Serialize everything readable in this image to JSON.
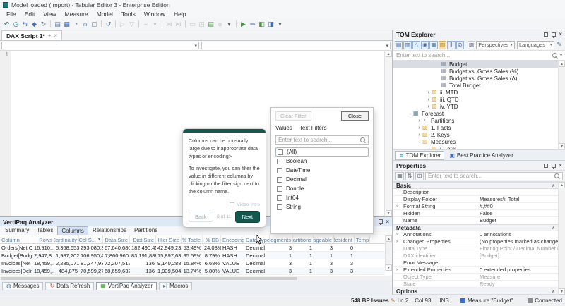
{
  "title_bar": {
    "title": "Model loaded (Import) - Tabular Editor 3 - Enterprise Edition"
  },
  "menu": [
    "File",
    "Edit",
    "View",
    "Measure",
    "Model",
    "Tools",
    "Window",
    "Help"
  ],
  "toolbar_icons": [
    {
      "name": "undo-icon",
      "g": "↶",
      "c": "#1f7a7a"
    },
    {
      "name": "history-icon",
      "g": "◷",
      "c": "#1f7a7a"
    },
    {
      "name": "sync-icon",
      "g": "⇆",
      "c": "#3a6bc9"
    },
    {
      "name": "deploy-icon",
      "g": "◆",
      "c": "#3a6bc9"
    },
    {
      "name": "refresh-icon",
      "g": "↻",
      "c": "#3a6bc9"
    },
    {
      "sep": true
    },
    {
      "name": "new-script-icon",
      "g": "▤",
      "c": "#5a7a9a"
    },
    {
      "name": "new-query-icon",
      "g": "▦",
      "c": "#3a6bc9"
    },
    {
      "name": "notifications-icon",
      "g": "◔",
      "c": "#5a7a9a"
    },
    {
      "name": "branch-icon",
      "g": "⋔",
      "c": "#5a7a9a"
    },
    {
      "name": "package-icon",
      "g": "▢",
      "c": "#5a7a9a"
    },
    {
      "sep": true
    },
    {
      "name": "refresh-model-icon",
      "g": "↺",
      "c": "#3a6bc9"
    },
    {
      "sep": true
    },
    {
      "name": "run-icon",
      "g": "▷",
      "c": "#777",
      "m": true
    },
    {
      "name": "stop-icon",
      "g": "▽",
      "c": "#777",
      "m": true
    },
    {
      "sep": true
    },
    {
      "name": "format-dax-icon",
      "g": "≡",
      "c": "#777",
      "m": true
    },
    {
      "name": "format-dropdown-icon",
      "g": "▾",
      "c": "#777",
      "m": true
    },
    {
      "sep": true
    },
    {
      "name": "hourglass-icon",
      "g": "⋈",
      "c": "#777",
      "m": true
    },
    {
      "name": "hourglass-alt-icon",
      "g": "⋈",
      "c": "#777",
      "m": true
    },
    {
      "sep": true
    },
    {
      "name": "comment-icon",
      "g": "▭",
      "c": "#777",
      "m": true
    },
    {
      "name": "chat-icon",
      "g": "◳",
      "c": "#777",
      "m": true
    },
    {
      "name": "save-layout-icon",
      "g": "▤",
      "c": "#3f9c35"
    },
    {
      "name": "tips-icon",
      "g": "☼",
      "c": "#999"
    },
    {
      "name": "tips-dropdown-icon",
      "g": "▾",
      "c": "#666"
    },
    {
      "sep": true
    },
    {
      "name": "play-icon",
      "g": "▶",
      "c": "#3f9c35"
    },
    {
      "name": "debug-icon",
      "g": "⇒",
      "c": "#3a6bc9"
    },
    {
      "name": "run-batch-icon",
      "g": "◧",
      "c": "#3f9c35"
    },
    {
      "name": "export-icon",
      "g": "◨",
      "c": "#3a6bc9"
    },
    {
      "name": "run-dropdown-icon",
      "g": "▾",
      "c": "#666"
    }
  ],
  "editor": {
    "tab_label": "DAX Script 1*",
    "new_tab_glyph": "+",
    "close_glyph": "×",
    "line1": "1"
  },
  "tom": {
    "title": "TOM Explorer",
    "toolbar_icons": [
      {
        "name": "toggle-measures-icon",
        "g": "▤",
        "style": "on"
      },
      {
        "name": "toggle-columns-icon",
        "g": "▥",
        "style": "on"
      },
      {
        "name": "toggle-hierarchies-icon",
        "g": "△",
        "style": "on"
      },
      {
        "name": "toggle-kpis-icon",
        "g": "◉",
        "style": "on"
      },
      {
        "name": "toggle-tables-icon",
        "g": "▦",
        "style": "on"
      },
      {
        "name": "toggle-folders-icon",
        "g": "▧",
        "style": "folder"
      },
      {
        "name": "toggle-hidden-icon",
        "g": "‖",
        "style": "on"
      },
      {
        "name": "toggle-disconnected-icon",
        "g": "⊘",
        "style": "on"
      },
      {
        "name": "flat-list-icon",
        "g": "▩",
        "style": "off"
      }
    ],
    "perspectives_label": "Perspectives",
    "languages_label": "Languages",
    "search_placeholder": "Enter text to search...",
    "tree": [
      {
        "label": "Budget",
        "type": "measure",
        "depth": 4,
        "selected": true
      },
      {
        "label": "Budget vs. Gross Sales (%)",
        "type": "measure",
        "depth": 4
      },
      {
        "label": "Budget vs. Gross Sales (Δ)",
        "type": "measure",
        "depth": 4
      },
      {
        "label": "Total Budget",
        "type": "measure",
        "depth": 4
      },
      {
        "label": "ii. MTD",
        "type": "folder",
        "depth": 3,
        "exp": "collapsed"
      },
      {
        "label": "iii. QTD",
        "type": "folder",
        "depth": 3,
        "exp": "collapsed"
      },
      {
        "label": "iv. YTD",
        "type": "folder",
        "depth": 3,
        "exp": "collapsed"
      },
      {
        "label": "Forecast",
        "type": "table",
        "depth": 1,
        "exp": "expanded"
      },
      {
        "label": "Partitions",
        "type": "partitions",
        "depth": 2,
        "exp": "collapsed"
      },
      {
        "label": "1. Facts",
        "type": "folder",
        "depth": 2,
        "exp": "collapsed"
      },
      {
        "label": "2. Keys",
        "type": "folder",
        "depth": 2,
        "exp": "collapsed"
      },
      {
        "label": "Measures",
        "type": "folder-open",
        "depth": 2,
        "exp": "expanded"
      },
      {
        "label": "i. Total",
        "type": "folder-open",
        "depth": 3,
        "exp": "expanded"
      }
    ],
    "tabs": [
      {
        "label": "TOM Explorer",
        "active": true
      },
      {
        "label": "Best Practice Analyzer",
        "active": false
      }
    ]
  },
  "properties": {
    "title": "Properties",
    "search_placeholder": "Enter text to search...",
    "sections": [
      {
        "name": "Basic",
        "rows": [
          {
            "label": "Description",
            "value": ""
          },
          {
            "label": "Display Folder",
            "value": "Measures\\i. Total"
          },
          {
            "label": "Format String",
            "value": "#,##0",
            "expand": true
          },
          {
            "label": "Hidden",
            "value": "False"
          },
          {
            "label": "Name",
            "value": "Budget"
          }
        ]
      },
      {
        "name": "Metadata",
        "rows": [
          {
            "label": "Annotations",
            "value": "0 annotations",
            "expand": true
          },
          {
            "label": "Changed Properties",
            "value": "(No properties marked as changed)",
            "expand": true
          },
          {
            "label": "Data Type",
            "value": "Floating Point / Decimal Number (dou...",
            "muted": true
          },
          {
            "label": "DAX identifier",
            "value": "[Budget]",
            "muted": true
          },
          {
            "label": "Error Message",
            "value": ""
          },
          {
            "label": "Extended Properties",
            "value": "0 extended properties",
            "expand": true
          },
          {
            "label": "Object Type",
            "value": "Measure",
            "muted": true
          },
          {
            "label": "State",
            "value": "Ready",
            "muted": true
          }
        ]
      },
      {
        "name": "Options",
        "rows": []
      }
    ]
  },
  "vertipaq": {
    "title": "VertiPaq Analyzer",
    "tabs": [
      "Summary",
      "Tables",
      "Columns",
      "Relationships",
      "Partitions"
    ],
    "active_tab": "Columns",
    "columns": [
      "Column",
      "Rows",
      "Cardinality",
      "Col S...",
      "Data Size",
      "Dict Size",
      "Hier Size",
      "% Table",
      "% DB",
      "Encoding",
      "Data Type",
      "Segments",
      "Partitions",
      "Pageable",
      "Resident",
      "Temper..."
    ],
    "sorted_column_index": 3,
    "rows": [
      [
        "Orders[Net Or...",
        "16,910,...",
        "5,368,653",
        "293,080,3...",
        "67,640,680",
        "182,490,456",
        "42,949,232",
        "53.49%",
        "24.08%",
        "HASH",
        "Decimal",
        "3",
        "1",
        "3",
        "0",
        ""
      ],
      [
        "Budget[Budget...",
        "2,947,8...",
        "1,987,202",
        "106,950,4...",
        "7,860,960",
        "83,191,888",
        "15,897,632",
        "95.59%",
        "8.79%",
        "HASH",
        "Decimal",
        "1",
        "1",
        "1",
        "1",
        ""
      ],
      [
        "Invoices[Net In...",
        "18,459,...",
        "2,285,071",
        "81,347,936",
        "72,207,512",
        "136",
        "9,140,288",
        "15.84%",
        "6.68%",
        "VALUE",
        "Decimal",
        "3",
        "1",
        "3",
        "3",
        ""
      ],
      [
        "Invoices[Delive...",
        "18,459,...",
        "484,875",
        "70,599,272",
        "68,659,632",
        "136",
        "1,939,504",
        "13.74%",
        "5.80%",
        "VALUE",
        "Decimal",
        "3",
        "1",
        "3",
        "3",
        ""
      ]
    ]
  },
  "filter_popup": {
    "clear_label": "Clear Filter",
    "close_label": "Close",
    "tabs": [
      "Values",
      "Text Filters"
    ],
    "search_placeholder": "Enter text to search...",
    "options": [
      "(All)",
      "Boolean",
      "DateTime",
      "Decimal",
      "Double",
      "Int64",
      "String"
    ]
  },
  "tour": {
    "paragraph1": "Columns can be unusually large due to inappropriate data types or encoding>",
    "paragraph2": "To investigate, you can filter the value in different columns by clicking on the filter sign next to the column name.",
    "video_label": "Video Intro",
    "back_label": "Back",
    "progress": "8 of 11",
    "next_label": "Next"
  },
  "bottom_tabs": [
    {
      "label": "Messages",
      "icon": "messages-icon",
      "g": "◍",
      "c": "#5a7a9a",
      "active": false
    },
    {
      "label": "Data Refresh",
      "icon": "data-refresh-icon",
      "g": "↻",
      "c": "#c9553a",
      "active": false
    },
    {
      "label": "VertiPaq Analyzer",
      "icon": "vertipaq-icon",
      "g": "▦",
      "c": "#3f9c35",
      "active": true
    },
    {
      "label": "Macros",
      "icon": "macros-icon",
      "g": "▸|",
      "c": "#5a7a9a",
      "active": false
    }
  ],
  "status_bar": {
    "bp_issues": "548 BP Issues",
    "edit_icon_glyph": "✎",
    "line": "Ln 2",
    "col": "Col 93",
    "mode": "INS",
    "object_label": "Measure \"Budget\"",
    "object_color": "#3a6bc9",
    "connection_label": "Connected",
    "connection_color": "#8a8f96"
  }
}
